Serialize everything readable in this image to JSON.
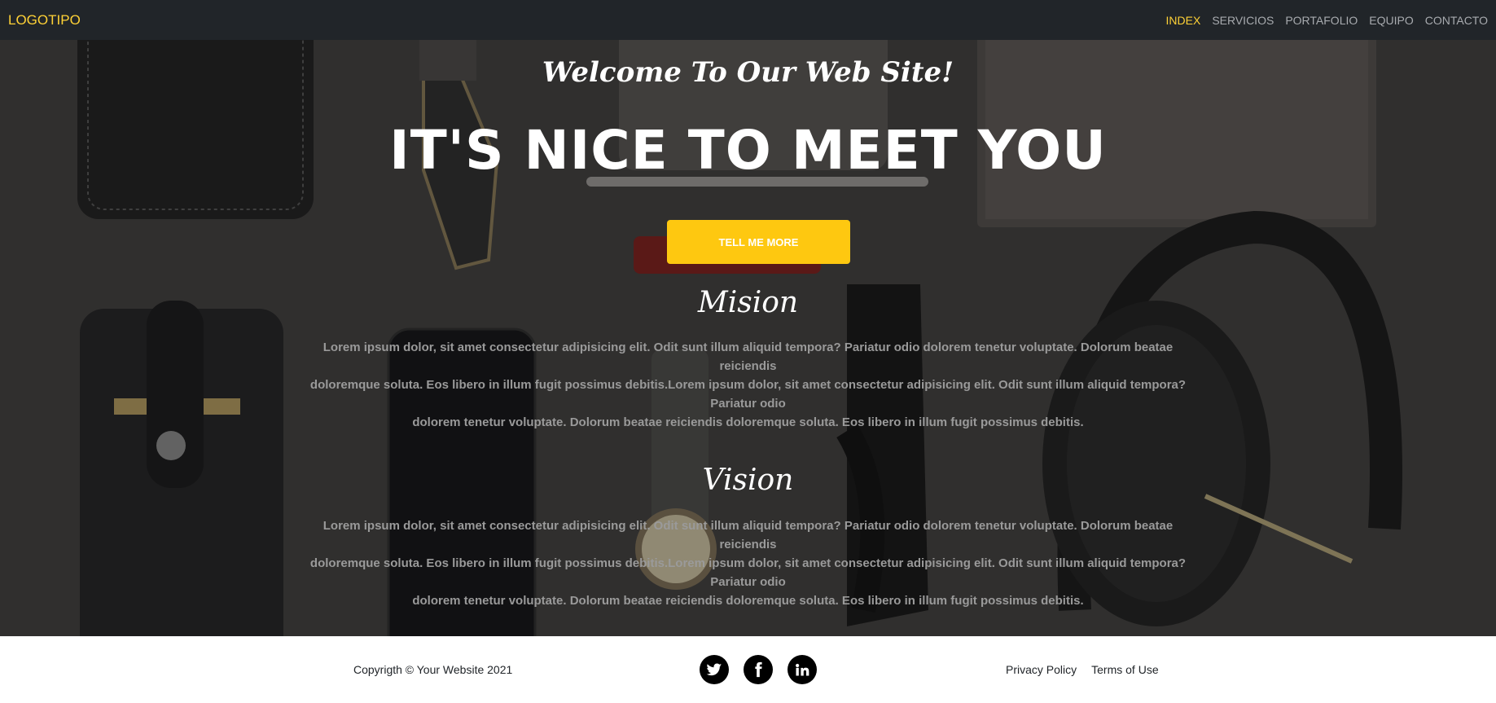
{
  "navbar": {
    "brand": "LOGOTIPO",
    "items": [
      {
        "label": "INDEX",
        "active": true
      },
      {
        "label": "SERVICIOS",
        "active": false
      },
      {
        "label": "PORTAFOLIO",
        "active": false
      },
      {
        "label": "EQUIPO",
        "active": false
      },
      {
        "label": "CONTACTO",
        "active": false
      }
    ]
  },
  "hero": {
    "welcome": "Welcome To Our Web Site!",
    "headline": "IT'S NICE TO MEET YOU",
    "cta_label": "TELL ME MORE"
  },
  "sections": {
    "mision": {
      "title": "Mision",
      "lines": [
        "Lorem ipsum dolor, sit amet consectetur adipisicing elit. Odit sunt illum aliquid tempora? Pariatur odio dolorem tenetur voluptate. Dolorum beatae reiciendis",
        "doloremque soluta. Eos libero in illum fugit possimus debitis.Lorem ipsum dolor, sit amet consectetur adipisicing elit. Odit sunt illum aliquid tempora? Pariatur odio",
        "dolorem tenetur voluptate. Dolorum beatae reiciendis doloremque soluta. Eos libero in illum fugit possimus debitis."
      ]
    },
    "vision": {
      "title": "Vision",
      "lines": [
        "Lorem ipsum dolor, sit amet consectetur adipisicing elit. Odit sunt illum aliquid tempora? Pariatur odio dolorem tenetur voluptate. Dolorum beatae reiciendis",
        "doloremque soluta. Eos libero in illum fugit possimus debitis.Lorem ipsum dolor, sit amet consectetur adipisicing elit. Odit sunt illum aliquid tempora? Pariatur odio",
        "dolorem tenetur voluptate. Dolorum beatae reiciendis doloremque soluta. Eos libero in illum fugit possimus debitis."
      ]
    }
  },
  "footer": {
    "copyright": "Copyrigth © Your Website 2021",
    "social": [
      "twitter-icon",
      "facebook-icon",
      "linkedin-icon"
    ],
    "links": [
      "Privacy Policy",
      "Terms of Use"
    ]
  },
  "colors": {
    "navbar_bg": "#212529",
    "accent": "#fed136",
    "button": "#fec810",
    "text_muted": "#9a9a9a"
  }
}
